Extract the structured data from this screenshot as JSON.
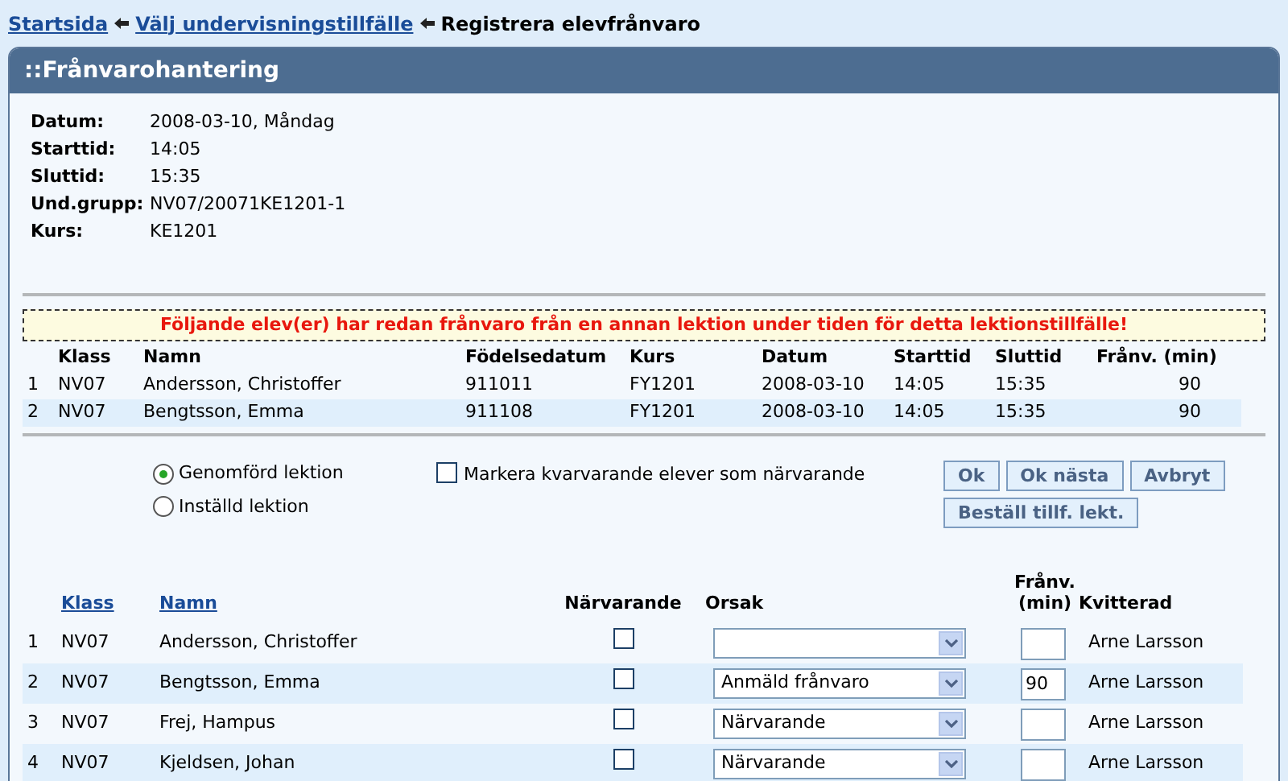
{
  "breadcrumb": [
    {
      "label": "Startsida",
      "kind": "link"
    },
    {
      "label": "Välj undervisningstillfälle",
      "kind": "link"
    },
    {
      "label": "Registrera elevfrånvaro",
      "kind": "current"
    }
  ],
  "panel": {
    "title": "::Frånvarohantering"
  },
  "info": [
    {
      "label": "Datum:",
      "value": "2008-03-10, Måndag"
    },
    {
      "label": "Starttid:",
      "value": "14:05"
    },
    {
      "label": "Sluttid:",
      "value": "15:35"
    },
    {
      "label": "Und.grupp:",
      "value": "NV07/20071KE1201-1"
    },
    {
      "label": "Kurs:",
      "value": "KE1201"
    }
  ],
  "warning": "Följande elev(er) har redan frånvaro från en annan lektion under tiden för detta lektionstillfälle!",
  "conflicts": {
    "columns": [
      "Klass",
      "Namn",
      "Födelsedatum",
      "Kurs",
      "Datum",
      "Starttid",
      "Sluttid",
      "Frånv. (min)"
    ],
    "rows": [
      {
        "number": "1",
        "cells": [
          "NV07",
          "Andersson, Christoffer",
          "911011",
          "FY1201",
          "2008-03-10",
          "14:05",
          "15:35",
          "90"
        ]
      },
      {
        "number": "2",
        "cells": [
          "NV07",
          "Bengtsson, Emma",
          "911108",
          "FY1201",
          "2008-03-10",
          "14:05",
          "15:35",
          "90"
        ]
      }
    ]
  },
  "options": {
    "radios": [
      {
        "label": "Genomförd lektion",
        "selected": true
      },
      {
        "label": "Inställd lektion",
        "selected": false
      }
    ],
    "checkbox": {
      "label": "Markera kvarvarande elever som närvarande",
      "checked": false
    }
  },
  "buttons": [
    [
      "Ok",
      "Ok nästa",
      "Avbryt"
    ],
    [
      "Beställ tillf. lekt."
    ]
  ],
  "attendance": {
    "columns": [
      {
        "label": "Klass",
        "kind": "link"
      },
      {
        "label": "Namn",
        "kind": "link"
      },
      {
        "label": "Närvarande",
        "kind": "text"
      },
      {
        "label": "Orsak",
        "kind": "text"
      },
      {
        "label": "Frånv. (min)",
        "kind": "text"
      },
      {
        "label": "Kvitterad",
        "kind": "text"
      }
    ],
    "rows": [
      {
        "number": "1",
        "klass": "NV07",
        "name": "Andersson, Christoffer",
        "present": false,
        "kvitterad": "Arne Larsson"
      },
      {
        "number": "2",
        "klass": "NV07",
        "name": "Bengtsson, Emma",
        "present": false,
        "reason": "Anmäld frånvaro",
        "minutes": "90",
        "kvitterad": "Arne Larsson"
      },
      {
        "number": "3",
        "klass": "NV07",
        "name": "Frej, Hampus",
        "present": false,
        "reason": "Närvarande",
        "kvitterad": "Arne Larsson"
      },
      {
        "number": "4",
        "klass": "NV07",
        "name": "Kjeldsen, Johan",
        "present": false,
        "reason": "Närvarande",
        "kvitterad": "Arne Larsson"
      }
    ]
  }
}
